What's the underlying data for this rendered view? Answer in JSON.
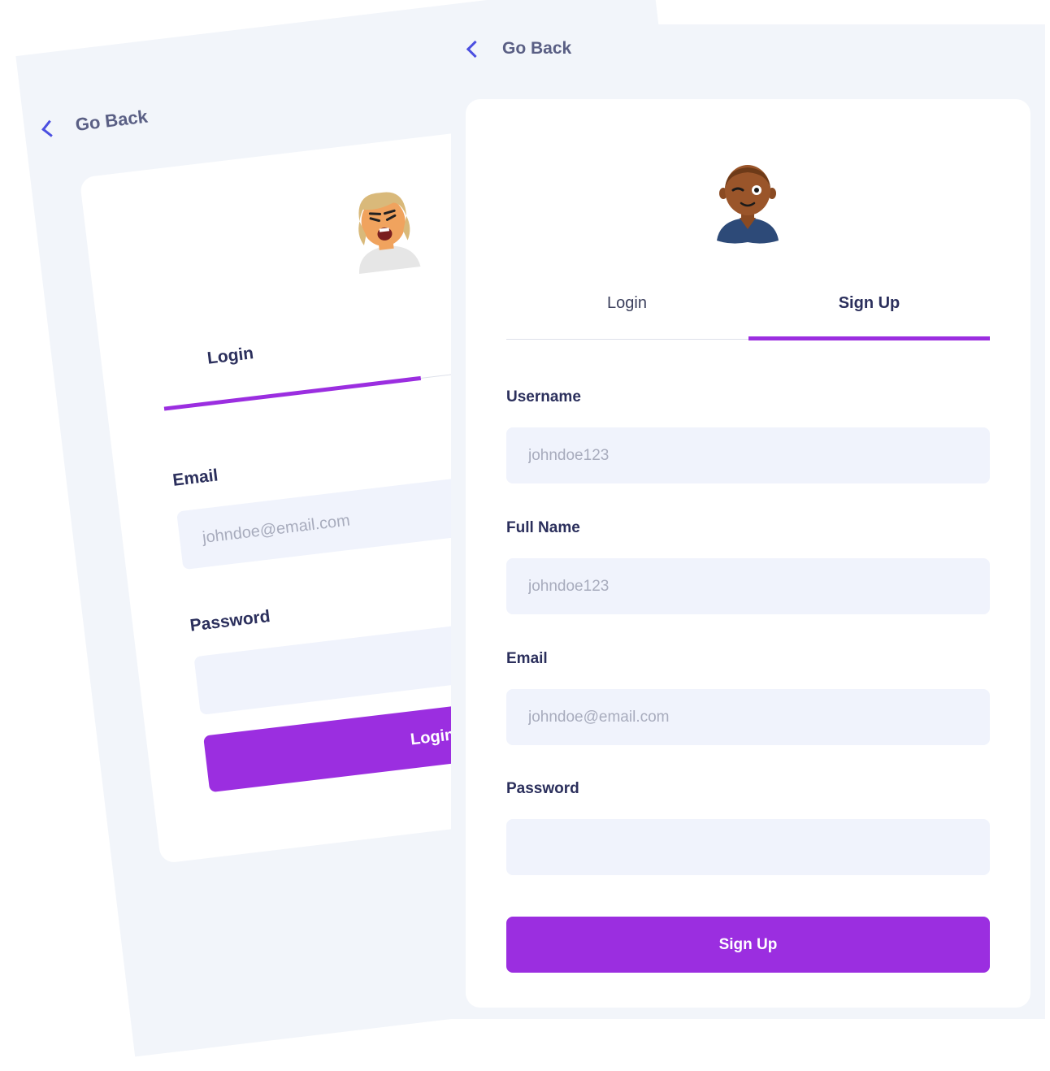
{
  "back_screen": {
    "go_back_label": "Go Back",
    "tabs": {
      "login": "Login"
    },
    "email_label": "Email",
    "email_placeholder": "johndoe@email.com",
    "password_label": "Password",
    "login_button": "Login"
  },
  "front_screen": {
    "go_back_label": "Go Back",
    "tabs": {
      "login": "Login",
      "signup": "Sign Up",
      "active": "signup"
    },
    "fields": {
      "username": {
        "label": "Username",
        "placeholder": "johndoe123"
      },
      "full_name": {
        "label": "Full Name",
        "placeholder": "johndoe123"
      },
      "email": {
        "label": "Email",
        "placeholder": "johndoe@email.com"
      },
      "password": {
        "label": "Password",
        "placeholder": ""
      }
    },
    "signup_button": "Sign Up"
  },
  "colors": {
    "accent": "#9b2ee0",
    "back_chevron": "#4b4fe0",
    "screen_bg": "#f2f5fa",
    "input_bg": "#f0f3fc"
  }
}
